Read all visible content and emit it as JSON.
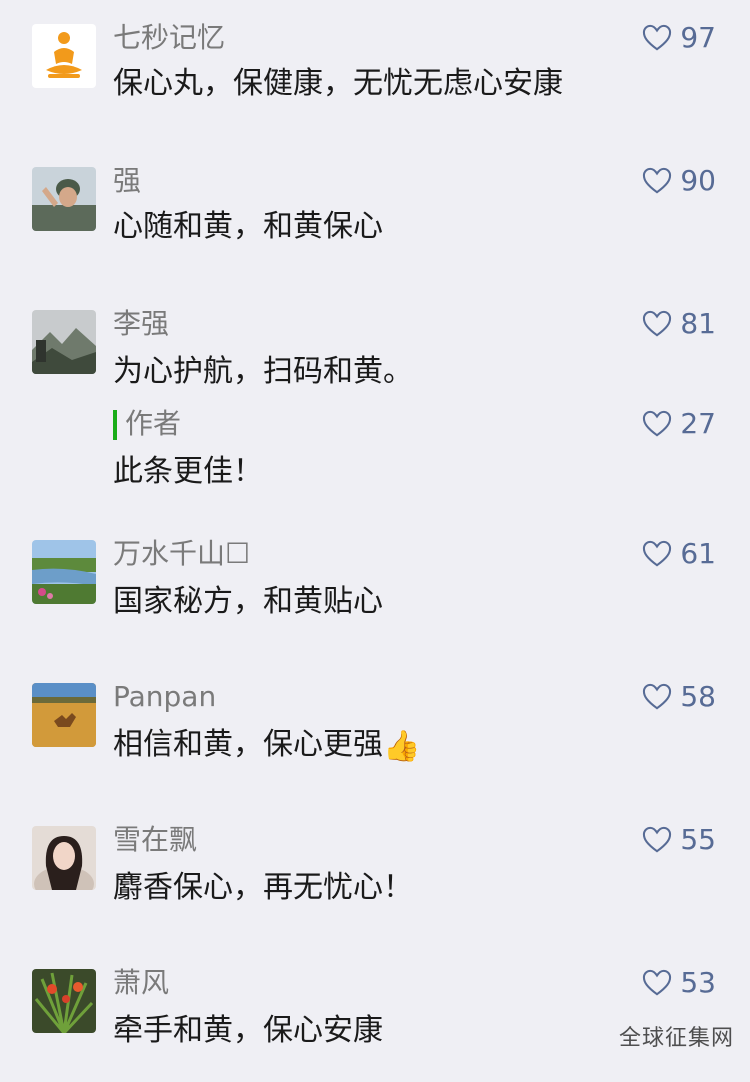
{
  "comments": [
    {
      "nickname": "七秒记忆",
      "text": "保心丸，保健康，无忧无虑心安康",
      "likes": "97",
      "avatar": "buddha-logo-avatar"
    },
    {
      "nickname": "强",
      "text": "心随和黄，和黄保心",
      "likes": "90",
      "avatar": "soldier-avatar"
    },
    {
      "nickname": "李强",
      "text": "为心护航，扫码和黄。",
      "likes": "81",
      "avatar": "mountain-avatar"
    },
    {
      "nickname": "万水千山☐",
      "text": "国家秘方，和黄贴心",
      "likes": "61",
      "avatar": "river-landscape-avatar"
    },
    {
      "nickname": "Panpan",
      "text": "相信和黄，保心更强",
      "likes": "58",
      "avatar": "deer-savanna-avatar"
    },
    {
      "nickname": "雪在飘",
      "text": "麝香保心，再无忧心！",
      "likes": "55",
      "avatar": "woman-portrait-avatar"
    },
    {
      "nickname": "萧风",
      "text": "牵手和黄，保心安康",
      "likes": "53",
      "avatar": "plant-flower-avatar"
    }
  ],
  "author_reply": {
    "label": "作者",
    "text": "此条更佳！",
    "likes": "27"
  },
  "emoji": {
    "thumbs_up": "👍"
  },
  "watermark": "全球征集网",
  "colors": {
    "like_blue": "#576b95",
    "author_green": "#1aad19",
    "background": "#efeff4"
  }
}
